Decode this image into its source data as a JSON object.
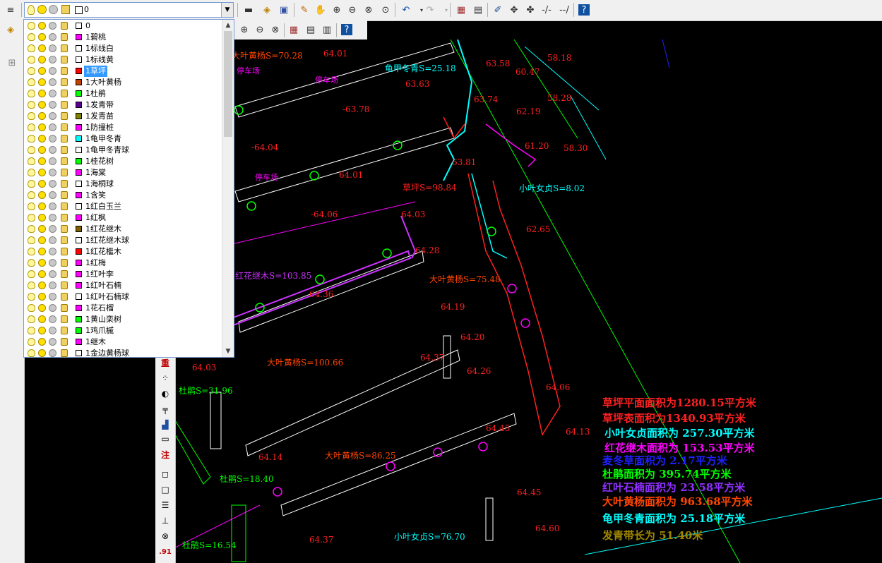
{
  "toolbar": {
    "layer_current": "0",
    "buttons": [
      "layer-properties-icon",
      "layer-previous-icon",
      "save-icon",
      "pencil-icon",
      "pan-icon",
      "zoom-realtime-icon",
      "zoom-window-icon",
      "zoom-previous-icon",
      "zoom-extents-icon",
      "undo-icon",
      "redo-icon",
      "properties-icon",
      "design-center-icon",
      "tool-palette-icon",
      "move-icon",
      "match-icon",
      "help-icon"
    ]
  },
  "layers": [
    {
      "name": "0",
      "color": "#ffffff"
    },
    {
      "name": "1碧桃",
      "color": "#ff00ff"
    },
    {
      "name": "1标线白",
      "color": "#ffffff"
    },
    {
      "name": "1标线黄",
      "color": "#ffffff"
    },
    {
      "name": "1草坪",
      "color": "#ff0000",
      "selected": true
    },
    {
      "name": "1大叶黄杨",
      "color": "#c04000"
    },
    {
      "name": "1杜鹃",
      "color": "#00ff00"
    },
    {
      "name": "1发青带",
      "color": "#5a0090"
    },
    {
      "name": "1发青苗",
      "color": "#808000"
    },
    {
      "name": "1防撞桩",
      "color": "#ff00ff"
    },
    {
      "name": "1龟甲冬青",
      "color": "#00ffff"
    },
    {
      "name": "1龟甲冬青球",
      "color": "#ffffff"
    },
    {
      "name": "1桂花树",
      "color": "#00ff00"
    },
    {
      "name": "1海棠",
      "color": "#ff00ff"
    },
    {
      "name": "1海桐球",
      "color": "#ffffff"
    },
    {
      "name": "1含笑",
      "color": "#ff00ff"
    },
    {
      "name": "1红白玉兰",
      "color": "#ffffff"
    },
    {
      "name": "1红枫",
      "color": "#ff00ff"
    },
    {
      "name": "1红花继木",
      "color": "#806000"
    },
    {
      "name": "1红花继木球",
      "color": "#ffffff"
    },
    {
      "name": "1红花檵木",
      "color": "#ff0000"
    },
    {
      "name": "1红梅",
      "color": "#ff00ff"
    },
    {
      "name": "1红叶李",
      "color": "#ff00ff"
    },
    {
      "name": "1红叶石楠",
      "color": "#ff00ff"
    },
    {
      "name": "1红叶石楠球",
      "color": "#ffffff"
    },
    {
      "name": "1花石榴",
      "color": "#ff00ff"
    },
    {
      "name": "1黄山栾树",
      "color": "#00ff00"
    },
    {
      "name": "1鸡爪槭",
      "color": "#00ff00"
    },
    {
      "name": "1继木",
      "color": "#ff00ff"
    },
    {
      "name": "1金边黄杨球",
      "color": "#ffffff"
    }
  ],
  "side_toolbar": [
    "重",
    "注"
  ],
  "drawing": {
    "labels": [
      {
        "text": "大叶黄杨S=70.28",
        "color": "#ff4500"
      },
      {
        "text": "龟甲冬青S=25.18",
        "color": "#00ffff"
      },
      {
        "text": "草坪S=98.84",
        "color": "#ff2020"
      },
      {
        "text": "小叶女贞S=8.02",
        "color": "#00ffff"
      },
      {
        "text": "红花继木S=103.85",
        "color": "#cc33ff"
      },
      {
        "text": "大叶黄杨S=75.48",
        "color": "#ff4500"
      },
      {
        "text": "大叶黄杨S=100.66",
        "color": "#ff4500"
      },
      {
        "text": "杜鹃S=31.96",
        "color": "#00ff00"
      },
      {
        "text": "大叶黄杨S=86.25",
        "color": "#ff4500"
      },
      {
        "text": "杜鹃S=18.40",
        "color": "#00ff00"
      },
      {
        "text": "小叶女贞S=76.70",
        "color": "#00ffff"
      },
      {
        "text": "杜鹃S=16.54",
        "color": "#00ff00"
      },
      {
        "text": "停车场",
        "color": "#ff00ff"
      },
      {
        "text": "停车场",
        "color": "#ff00ff"
      },
      {
        "text": "停车场",
        "color": "#ff00ff"
      }
    ],
    "elevations": [
      "-63.78",
      "63.63",
      "-64.04",
      "64.01",
      "-64.06",
      "64.03",
      "64.28",
      "64.36",
      "64.19",
      "64.20",
      "64.37",
      "64.26",
      "64.45",
      "64.13",
      "64.14",
      "64.45",
      "64.60",
      "64.37",
      "62.65",
      "61.20",
      "58.30",
      "58.18",
      "58.28",
      "60.47",
      "63.74",
      "62.19",
      "63.81",
      "64.06",
      "64.03",
      "64.01",
      "63.58"
    ],
    "summary": [
      {
        "text": "草坪平面面积为1280.15平方米",
        "color": "#ff2020"
      },
      {
        "text": "草坪表面积为1340.93平方米",
        "color": "#ff2020"
      },
      {
        "text": "小叶女贞面积为 257.30平方米",
        "color": "#00ffff"
      },
      {
        "text": "红花继木面积为 153.53平方米",
        "color": "#ff00ff"
      },
      {
        "text": "麦冬草面积为 2.17平方米",
        "color": "#2020ff"
      },
      {
        "text": "杜鹃面积为 395.74平方米",
        "color": "#00ff00"
      },
      {
        "text": "红叶石楠面积为 23.58平方米",
        "color": "#9030ff"
      },
      {
        "text": "大叶黄杨面积为 963.68平方米",
        "color": "#ff4500"
      },
      {
        "text": "龟甲冬青面积为 25.18平方米",
        "color": "#00ffff"
      },
      {
        "text": "发青带长为 51.40米",
        "color": "#a08800"
      }
    ]
  }
}
